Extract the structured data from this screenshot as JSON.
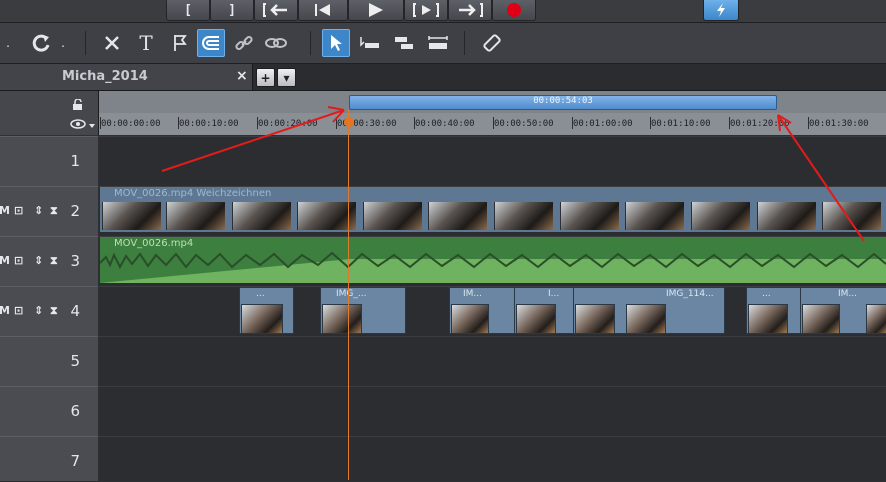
{
  "transport": {
    "buttons": [
      "[",
      "]"
    ],
    "record_color": "#e00016",
    "accent_color": "#3d87c9"
  },
  "toolbar": {
    "icons": [
      "undo-dropdown-icon",
      "redo-icon",
      "delete-icon",
      "title-icon",
      "marker-icon",
      "magnet-icon",
      "link-icon",
      "unlink-icon",
      "pointer-icon",
      "range-tool-icon",
      "trim-tool-icon",
      "stretch-tool-icon",
      "razor-icon"
    ]
  },
  "tabs": {
    "project_title": "Micha_2014",
    "close_label": "×",
    "add_label": "+",
    "menu_label": "▾"
  },
  "ruler": {
    "range_duration": "00:00:54:03",
    "ticks": [
      "00:00:00:00",
      "00:00:10:00",
      "00:00:20:00",
      "00:00:30:00",
      "00:00:40:00",
      "00:00:50:00",
      "00:01:00:00",
      "00:01:10:00",
      "00:01:20:00",
      "00:01:30:00"
    ]
  },
  "tracks": [
    {
      "number": "1"
    },
    {
      "number": "2",
      "controls": "M",
      "clip_label": "MOV_0026.mp4   Weichzeichnen"
    },
    {
      "number": "3",
      "controls": "M",
      "clip_label": "MOV_0026.mp4"
    },
    {
      "number": "4",
      "controls": "M",
      "photo_labels": [
        "...",
        "IMG_...",
        "IM...",
        "I...",
        "IMG_114...",
        "...",
        "IM..."
      ]
    },
    {
      "number": "5"
    },
    {
      "number": "6"
    },
    {
      "number": "7"
    }
  ]
}
